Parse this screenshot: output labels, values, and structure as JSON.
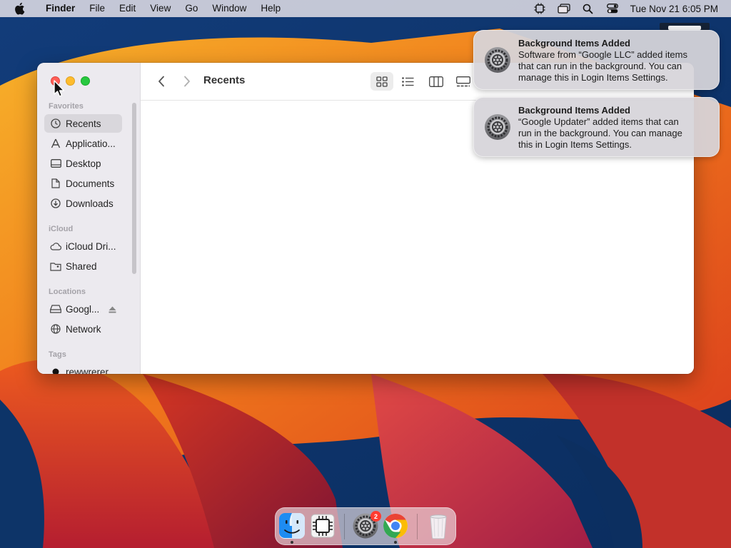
{
  "menubar": {
    "app_name": "Finder",
    "menus": [
      "File",
      "Edit",
      "View",
      "Go",
      "Window",
      "Help"
    ],
    "clock": "Tue Nov 21  6:05 PM",
    "status_icons": [
      "cpu-icon",
      "screen-mirroring-icon",
      "spotlight-search-icon",
      "control-center-icon"
    ]
  },
  "finder": {
    "title": "Recents",
    "sidebar": {
      "favorites_header": "Favorites",
      "icloud_header": "iCloud",
      "locations_header": "Locations",
      "tags_header": "Tags",
      "items": {
        "recents": "Recents",
        "applications": "Applicatio...",
        "desktop": "Desktop",
        "documents": "Documents",
        "downloads": "Downloads",
        "icloud_drive": "iCloud Dri...",
        "shared": "Shared",
        "google": "Googl...",
        "network": "Network",
        "tag1": "rewwrerer"
      }
    },
    "view_modes": [
      "icon-view",
      "list-view",
      "column-view",
      "gallery-view"
    ],
    "selected_view": "icon-view"
  },
  "notifications": [
    {
      "title": "Background Items Added",
      "body_lines": [
        "Software from “Google LLC” added items",
        "that can run in the background. You can",
        "manage this in Login Items Settings."
      ]
    },
    {
      "title": "Background Items Added",
      "body_lines": [
        "“Google Updater” added items that can",
        "run in the background. You can manage",
        "this in Login Items Settings."
      ]
    }
  ],
  "dock": {
    "apps": [
      "Finder",
      "System Information",
      "System Settings",
      "Google Chrome",
      "Trash"
    ],
    "system_settings_badge": "2"
  },
  "colors": {
    "selected_sidebar": "#d9d7dc",
    "close": "#ff5f57",
    "minimize": "#febc2e",
    "maximize": "#28c840",
    "badge": "#ff3b30"
  }
}
